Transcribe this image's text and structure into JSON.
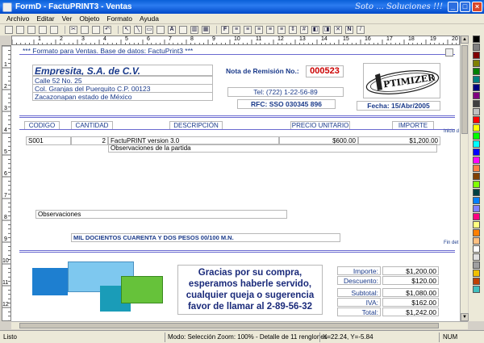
{
  "window": {
    "title": "FormD - FactuPRINT3 - Ventas",
    "slogan": "Soto ... Soluciones !!!"
  },
  "menu": [
    "Archivo",
    "Editar",
    "Ver",
    "Objeto",
    "Formato",
    "Ayuda"
  ],
  "ruler": {
    "h": [
      "1",
      "2",
      "3",
      "4",
      "5",
      "6",
      "7",
      "8",
      "9",
      "10",
      "11",
      "12",
      "13",
      "14",
      "15",
      "16",
      "17",
      "18",
      "19",
      "20"
    ],
    "v": [
      "1",
      "2",
      "3",
      "4",
      "5",
      "6",
      "7",
      "8",
      "9",
      "10",
      "11",
      "12",
      "13"
    ]
  },
  "form": {
    "caption": "*** Formato para Ventas. Base de datos: FactuPrint3 ***",
    "company": "Empresita, S.A. de C.V.",
    "address1": "Calle 52 No. 25",
    "address2": "Col. Granjas del Puerquito C.P. 00123",
    "address3": "Zacazonapan estado de México",
    "remision_label": "Nota de Remisión No.:",
    "remision_no": "000523",
    "tel": "Tel: (722) 1-22-56-89",
    "rfc": "RFC: SSO 030345 896",
    "fecha": "Fecha: 15/Abr/2005",
    "logo_text": "PTIMIZER",
    "col_codigo": "CODIGO",
    "col_cantidad": "CANTIDAD",
    "col_descripcion": "DESCRIPCIÓN",
    "col_precio": "PRECIO UNITARIO",
    "col_importe": "IMPORTE",
    "inicio_marker": "Inicio d",
    "row_code": "S001",
    "row_qty": "2",
    "row_desc": "FactuPRINT version 3.0",
    "row_price": "$600.00",
    "row_amount": "$1,200.00",
    "row_obs": "Observaciones de la partida",
    "observaciones": "Observaciones",
    "amount_words": "MIL DOCIENTOS CUARENTA Y DOS PESOS 00/100 M.N.",
    "fin_marker": "Fin det",
    "thanks": "Gracias por su compra, esperamos haberle servido, cualquier queja o sugerencia favor de llamar al 2-89-56-32",
    "importe_label": "Importe:",
    "importe": "$1,200.00",
    "descuento_label": "Descuento:",
    "descuento": "$120.00",
    "subtotal_label": "Subtotal:",
    "subtotal": "$1,080.00",
    "iva_label": "IVA:",
    "iva": "$162.00",
    "total_label": "Total:",
    "total": "$1,242.00"
  },
  "status": {
    "left": "Listo",
    "mode": "Modo: Selección  Zoom: 100% - Detalle de 11 renglones",
    "coords": "X=22.24, Y=-5.84",
    "num": "NUM"
  },
  "palette": [
    "#000000",
    "#808080",
    "#800000",
    "#808000",
    "#008000",
    "#008080",
    "#000080",
    "#800080",
    "#404040",
    "#c0c0c0",
    "#ff0000",
    "#ffff00",
    "#00ff00",
    "#00ffff",
    "#0000ff",
    "#ff00ff",
    "#ff8040",
    "#804000",
    "#80ff00",
    "#004040",
    "#0080ff",
    "#8080ff",
    "#ff0080",
    "#ffff80",
    "#ff8000",
    "#ffc080",
    "#ffffff",
    "#e0e0e0",
    "#a0a0a0",
    "#f0c000",
    "#c04000",
    "#40c0c0"
  ],
  "colors": {
    "accent_blue": "#1a3a8a",
    "remision_red": "#cc0000",
    "rect1": "#1e7fd0",
    "rect2": "#7ec8ef",
    "rect3": "#1a9cb8",
    "rect4": "#66c23a"
  }
}
